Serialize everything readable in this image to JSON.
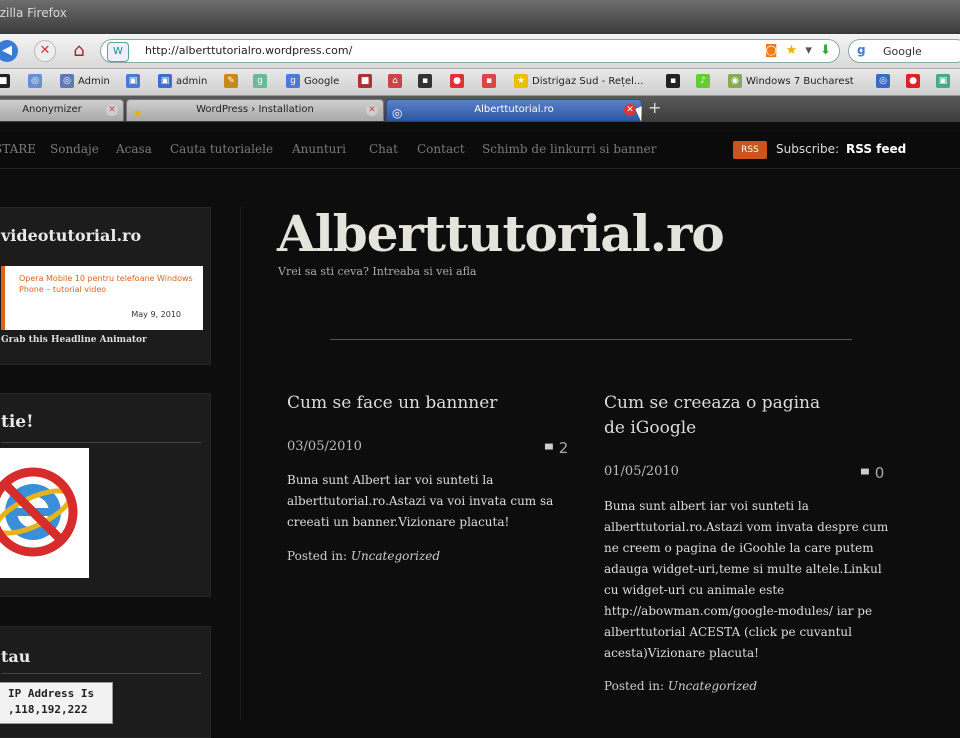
{
  "browser": {
    "window_title": "Mozilla Firefox",
    "url": "http://alberttutorialro.wordpress.com/",
    "search_engine": "Google",
    "bookmarks": [
      "Admin",
      "admin",
      "Google",
      "Distrigaz Sud - Rețel...",
      "Windows 7 Bucharest"
    ],
    "tabs": [
      {
        "label": "Anonymizer"
      },
      {
        "label": "WordPress › Installation"
      },
      {
        "label": "Alberttutorial.ro",
        "active": true
      }
    ]
  },
  "site_nav": {
    "items": [
      "STARE",
      "Sondaje",
      "Acasa",
      "Cauta tutorialele",
      "Anunturi",
      "Chat",
      "Contact",
      "Schimb de linkurri si banner"
    ],
    "rss_badge": "RSS",
    "subscribe_label": "Subscribe:",
    "rss_feed": "RSS feed"
  },
  "sidebar": {
    "widget1": {
      "title": "videotutorial.ro",
      "headline": "Opera Mobile 10 pentru telefoane Windows Phone – tutorial video",
      "date": "May 9, 2010",
      "grab": "Grab this Headline Animator"
    },
    "widget2": {
      "title": "tie!"
    },
    "widget3": {
      "title": "tau",
      "ip_line1": "IP Address Is",
      "ip_line2": ",118,192,222"
    }
  },
  "site": {
    "title": "Alberttutorial.ro",
    "tagline": "Vrei sa sti ceva? Intreaba si vei afla"
  },
  "posts": [
    {
      "title": "Cum se face un bannner",
      "date": "03/05/2010",
      "comments": "2",
      "body": "Buna sunt Albert iar voi sunteti la alberttutorial.ro.Astazi va voi invata cum sa creeati un banner.Vizionare placuta!",
      "posted_in_label": "Posted in:",
      "category": "Uncategorized"
    },
    {
      "title": "Cum se creeaza o pagina de iGoogle",
      "date": "01/05/2010",
      "comments": "0",
      "body": "Buna sunt albert iar voi sunteti la alberttutorial.ro.Astazi vom invata despre cum ne creem o pagina de iGoohle la care putem adauga widget-uri,teme si multe altele.Linkul cu widget-uri cu animale este http://abowman.com/google-modules/ iar pe alberttutorial ACESTA (click pe cuvantul acesta)Vizionare placuta!",
      "posted_in_label": "Posted in:",
      "category": "Uncategorized"
    }
  ]
}
